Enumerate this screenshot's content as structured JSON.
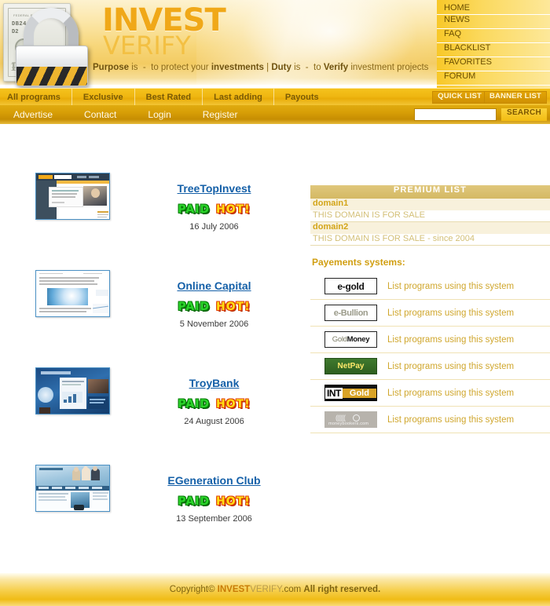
{
  "site": {
    "logo_primary": "INVEST",
    "logo_secondary": "VERIFY",
    "tagline_html": "Purpose is  -  to protect your investments | Duty is  -  to Verify investment projects"
  },
  "top_menu": {
    "items": [
      {
        "label": "HOME"
      },
      {
        "label": "NEWS"
      },
      {
        "label": "FAQ"
      },
      {
        "label": "BLACKLIST"
      },
      {
        "label": "FAVORITES"
      },
      {
        "label": "FORUM"
      }
    ]
  },
  "nav_primary": {
    "items": [
      {
        "label": "All programs"
      },
      {
        "label": "Exclusive"
      },
      {
        "label": "Best Rated"
      },
      {
        "label": "Last adding"
      },
      {
        "label": "Payouts"
      }
    ],
    "quick_list": "QUICK LIST",
    "banner_list": "BANNER LIST"
  },
  "nav_secondary": {
    "items": [
      {
        "label": "Advertise"
      },
      {
        "label": "Contact"
      },
      {
        "label": "Login"
      },
      {
        "label": "Register"
      }
    ],
    "search_value": "",
    "search_placeholder": "",
    "search_button": "SEARCH"
  },
  "programs": [
    {
      "name": "TreeTopInvest",
      "badge_paid": "PAID",
      "badge_hot": "HOT!",
      "date": "16 July 2006"
    },
    {
      "name": "Online Capital",
      "badge_paid": "PAID",
      "badge_hot": "HOT!",
      "date": "5 November 2006"
    },
    {
      "name": "TroyBank",
      "badge_paid": "PAID",
      "badge_hot": "HOT!",
      "date": "24 August 2006"
    },
    {
      "name": "EGeneration Club",
      "badge_paid": "PAID",
      "badge_hot": "HOT!",
      "date": "13 September 2006"
    }
  ],
  "premium_list": {
    "header": "PREMIUM LIST",
    "entries": [
      {
        "domain": "domain1",
        "description": "THIS DOMAIN IS FOR SALE"
      },
      {
        "domain": "domain2",
        "description": "THIS DOMAIN IS FOR SALE - since 2004"
      }
    ]
  },
  "payment_systems": {
    "title": "Payements systems:",
    "link_label": "List programs using this system",
    "items": [
      {
        "name": "e-gold",
        "logo": "egold-logo"
      },
      {
        "name": "e-Bullion",
        "logo": "ebullion-logo"
      },
      {
        "name": "GoldMoney",
        "logo": "goldmoney-logo"
      },
      {
        "name": "NetPay",
        "logo": "netpay-logo"
      },
      {
        "name": "INTGold",
        "logo": "intgold-logo"
      },
      {
        "name": "moneybookers.com",
        "logo": "moneybookers-logo"
      }
    ]
  },
  "footer": {
    "copyright_prefix": "Copyright© ",
    "brand_invest": "INVEST",
    "brand_verify": "VERIFY",
    "brand_suffix": ".com ",
    "rights": "All right reserved."
  },
  "colors": {
    "brand_gold": "#f0a818",
    "nav_gold": "#efb712",
    "link_blue": "#1560a8",
    "premium_header": "#d4b964"
  }
}
